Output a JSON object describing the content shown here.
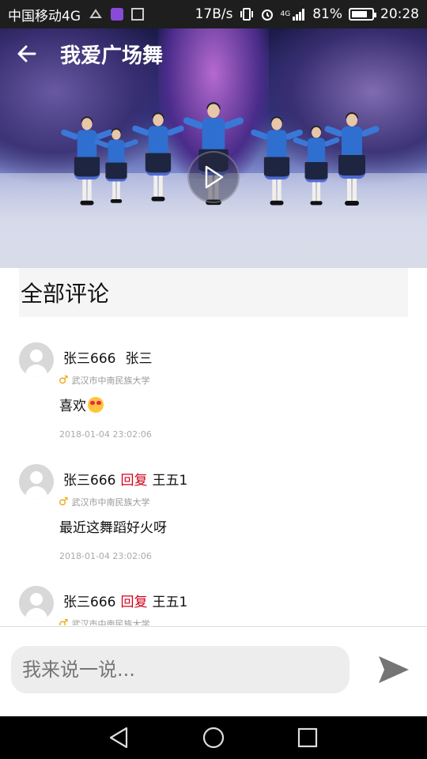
{
  "status_bar": {
    "carrier": "中国移动4G",
    "speed": "17B/s",
    "network": "4G",
    "battery": "81%",
    "battery_level": 0.81,
    "time": "20:28"
  },
  "header": {
    "title": "我爱广场舞",
    "back_icon": "arrow-left-icon",
    "play_icon": "play-icon"
  },
  "comments": {
    "heading": "全部评论",
    "items": [
      {
        "user": "张三666",
        "reply_label": "",
        "target": "张三",
        "location": "武汉市中南民族大学",
        "content": "喜欢",
        "has_emoji": true,
        "time": "2018-01-04 23:02:06"
      },
      {
        "user": "张三666",
        "reply_label": "回复",
        "target": "王五1",
        "location": "武汉市中南民族大学",
        "content": "最近这舞蹈好火呀",
        "has_emoji": false,
        "time": "2018-01-04 23:02:06"
      },
      {
        "user": "张三666",
        "reply_label": "回复",
        "target": "王五1",
        "location": "武汉市中南民族大学",
        "content": "",
        "has_emoji": false,
        "time": ""
      }
    ]
  },
  "input": {
    "placeholder": "我来说一说..."
  },
  "colors": {
    "reply": "#d0021b",
    "gender": "#f0a000",
    "statusbar": "#1e1e1e"
  }
}
